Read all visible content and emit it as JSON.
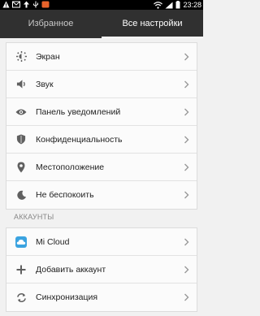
{
  "status_bar": {
    "time": "23:28"
  },
  "tabs": [
    {
      "label": "Избранное"
    },
    {
      "label": "Все настройки"
    }
  ],
  "general_items": [
    {
      "label": "Экран",
      "icon": "brightness-icon"
    },
    {
      "label": "Звук",
      "icon": "speaker-icon"
    },
    {
      "label": "Панель уведомлений",
      "icon": "eye-icon"
    },
    {
      "label": "Конфиденциальность",
      "icon": "shield-icon"
    },
    {
      "label": "Местоположение",
      "icon": "location-pin-icon"
    },
    {
      "label": "Не беспокоить",
      "icon": "moon-icon"
    }
  ],
  "accounts_section": {
    "title": "АККАУНТЫ",
    "items": [
      {
        "label": "Mi Cloud",
        "icon": "cloud-icon"
      },
      {
        "label": "Добавить аккаунт",
        "icon": "plus-icon"
      },
      {
        "label": "Синхронизация",
        "icon": "sync-icon"
      }
    ]
  },
  "colors": {
    "tab_bar": "#303030",
    "mi_cloud_icon": "#3ba3e0"
  }
}
